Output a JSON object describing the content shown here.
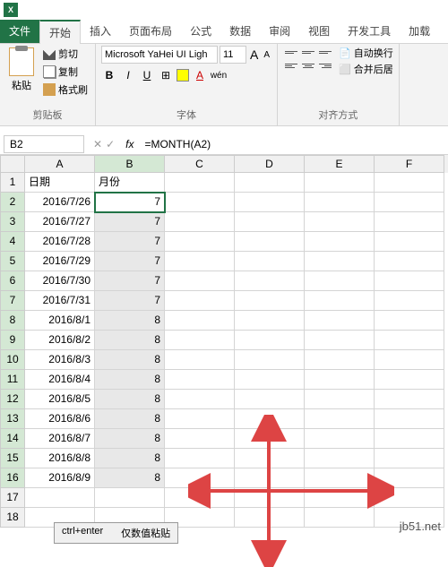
{
  "app": {
    "icon_text": "X"
  },
  "tabs": {
    "file": "文件",
    "home": "开始",
    "insert": "插入",
    "layout": "页面布局",
    "formulas": "公式",
    "data": "数据",
    "review": "审阅",
    "view": "视图",
    "dev": "开发工具",
    "addins": "加载"
  },
  "clipboard": {
    "paste": "粘贴",
    "cut": "剪切",
    "copy": "复制",
    "format_painter": "格式刷",
    "group": "剪贴板"
  },
  "font": {
    "name": "Microsoft YaHei UI Ligh",
    "size": "11",
    "group": "字体",
    "bold": "B",
    "italic": "I",
    "underline": "U",
    "aa_big": "A",
    "aa_small": "A"
  },
  "align": {
    "wrap": "自动换行",
    "merge": "合并后居",
    "group": "对齐方式"
  },
  "namebox": "B2",
  "formula": "=MONTH(A2)",
  "columns": [
    "A",
    "B",
    "C",
    "D",
    "E",
    "F"
  ],
  "rows": [
    {
      "n": "1",
      "a": "日期",
      "b": "月份",
      "header": true
    },
    {
      "n": "2",
      "a": "2016/7/26",
      "b": "7",
      "active": true
    },
    {
      "n": "3",
      "a": "2016/7/27",
      "b": "7"
    },
    {
      "n": "4",
      "a": "2016/7/28",
      "b": "7"
    },
    {
      "n": "5",
      "a": "2016/7/29",
      "b": "7"
    },
    {
      "n": "6",
      "a": "2016/7/30",
      "b": "7"
    },
    {
      "n": "7",
      "a": "2016/7/31",
      "b": "7"
    },
    {
      "n": "8",
      "a": "2016/8/1",
      "b": "8"
    },
    {
      "n": "9",
      "a": "2016/8/2",
      "b": "8"
    },
    {
      "n": "10",
      "a": "2016/8/3",
      "b": "8"
    },
    {
      "n": "11",
      "a": "2016/8/4",
      "b": "8"
    },
    {
      "n": "12",
      "a": "2016/8/5",
      "b": "8"
    },
    {
      "n": "13",
      "a": "2016/8/6",
      "b": "8"
    },
    {
      "n": "14",
      "a": "2016/8/7",
      "b": "8"
    },
    {
      "n": "15",
      "a": "2016/8/8",
      "b": "8"
    },
    {
      "n": "16",
      "a": "2016/8/9",
      "b": "8"
    },
    {
      "n": "17",
      "a": "",
      "b": "",
      "empty": true
    },
    {
      "n": "18",
      "a": "",
      "b": "",
      "empty": true
    }
  ],
  "watermark": "jb51.net",
  "dialog": {
    "left": "ctrl+enter",
    "right": "仅数值粘贴"
  },
  "annotation": {
    "type": "red-cross-arrows"
  }
}
